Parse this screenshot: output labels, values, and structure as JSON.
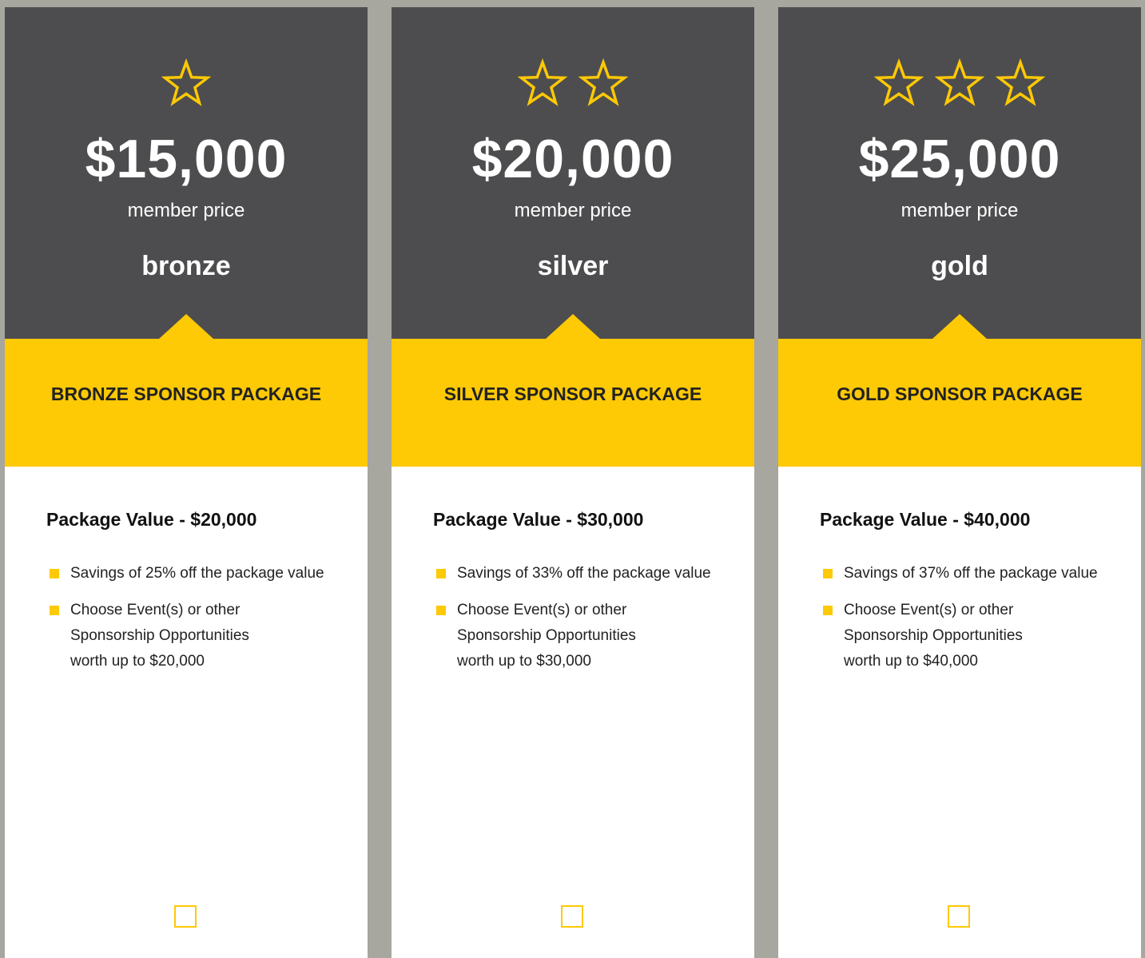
{
  "colors": {
    "background": "#a7a69f",
    "card_top": "#4d4d4f",
    "accent": "#fec905",
    "card_body": "#ffffff"
  },
  "cards": [
    {
      "stars": 1,
      "price": "$15,000",
      "price_note": "member price",
      "tier": "bronze",
      "package_title": "BRONZE SPONSOR PACKAGE",
      "value_heading": "Package Value - $20,000",
      "bullet_savings": "Savings of 25% off the package value",
      "bullet_choose_lines": [
        "Choose Event(s) or other",
        "Sponsorship Opportunities",
        "worth up to $20,000"
      ]
    },
    {
      "stars": 2,
      "price": "$20,000",
      "price_note": "member price",
      "tier": "silver",
      "package_title": "SILVER SPONSOR PACKAGE",
      "value_heading": "Package Value - $30,000",
      "bullet_savings": "Savings of 33% off the package value",
      "bullet_choose_lines": [
        "Choose Event(s) or other",
        "Sponsorship Opportunities",
        "worth up to $30,000"
      ]
    },
    {
      "stars": 3,
      "price": "$25,000",
      "price_note": "member price",
      "tier": "gold",
      "package_title": "GOLD SPONSOR PACKAGE",
      "value_heading": "Package Value - $40,000",
      "bullet_savings": "Savings of 37% off the package value",
      "bullet_choose_lines": [
        "Choose Event(s) or other",
        "Sponsorship Opportunities",
        "worth up to $40,000"
      ]
    }
  ],
  "icons": {
    "rating": "star-outline-icon",
    "bullet": "square-bullet-icon",
    "select": "checkbox-icon"
  }
}
